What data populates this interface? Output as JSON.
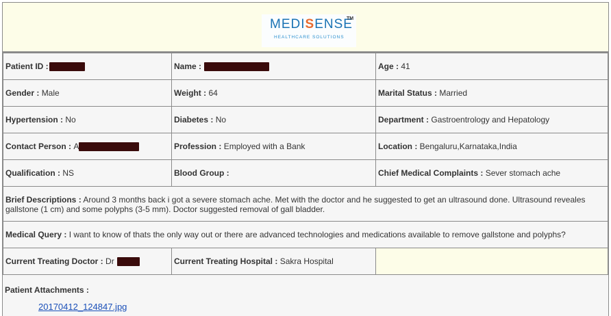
{
  "logo": {
    "brand_prefix": "MEDI",
    "brand_mark": "S",
    "brand_suffix": "ENSE",
    "trademark": "TM",
    "tagline": "HEALTHCARE SOLUTIONS"
  },
  "patient": {
    "patient_id_label": "Patient ID :",
    "name_label": "Name :",
    "age_label": "Age :",
    "age_value": "41",
    "gender_label": "Gender :",
    "gender_value": "Male",
    "weight_label": "Weight :",
    "weight_value": "64",
    "marital_label": "Marital Status :",
    "marital_value": "Married",
    "hypertension_label": "Hypertension :",
    "hypertension_value": "No",
    "diabetes_label": "Diabetes :",
    "diabetes_value": "No",
    "department_label": "Department :",
    "department_value": "Gastroentrology and Hepatology",
    "contact_label": "Contact Person :",
    "contact_prefix": "A",
    "profession_label": "Profession :",
    "profession_value": "Employed with a Bank",
    "location_label": "Location :",
    "location_value": "Bengaluru,Karnataka,India",
    "qualification_label": "Qualification :",
    "qualification_value": "NS",
    "blood_group_label": "Blood Group :",
    "blood_group_value": "",
    "complaints_label": "Chief Medical Complaints :",
    "complaints_value": "Sever stomach ache"
  },
  "brief": {
    "label": "Brief Descriptions :",
    "text": "Around 3 months back i got a severe stomach ache. Met with the doctor and he suggested to get an ultrasound done. Ultrasound reveales gallstone (1 cm) and some polyphs (3-5 mm). Doctor suggested removal of gall bladder."
  },
  "query": {
    "label": "Medical Query :",
    "text": "I want to know of thats the only way out or there are advanced technologies and medications available to remove gallstone and polyphs?"
  },
  "treatment": {
    "doctor_label": "Current Treating Doctor :",
    "doctor_prefix": "Dr",
    "hospital_label": "Current Treating Hospital :",
    "hospital_value": "Sakra Hospital"
  },
  "attachments": {
    "label": "Patient Attachments :",
    "file": "20170412_124847.jpg"
  },
  "colors": {
    "redaction": "#3a0b0b",
    "header_bg": "#fdfde8",
    "cell_bg": "#f6f6f6",
    "border": "#8a8a8a",
    "link": "#1a4fb8"
  }
}
